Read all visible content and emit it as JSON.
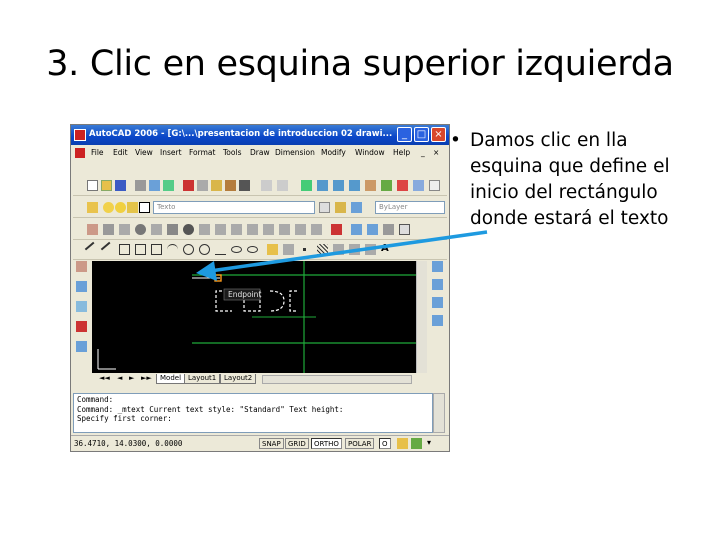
{
  "slide": {
    "title": "3. Clic en esquina superior izquierda",
    "bullet": "Damos clic en lla esquina que define el inicio del rectángulo donde estará el texto",
    "bullet_marker": "•"
  },
  "app": {
    "window_title": "AutoCAD 2006 - [G:\\...\\presentacion de introduccion 02 drawi...",
    "menu": [
      "File",
      "Edit",
      "View",
      "Insert",
      "Format",
      "Tools",
      "Draw",
      "Dimension",
      "Modify",
      "Window",
      "Help"
    ],
    "text_style_value": "Texto",
    "layer_value": "ByLayer",
    "snap_tooltip": "Endpoint",
    "tabs": [
      "Model",
      "Layout1",
      "Layout2"
    ],
    "command_lines": [
      "Command:",
      "Command: _mtext  Current text style:  \"Standard\"  Text height:",
      "Specify first corner:"
    ],
    "coords": "36.4710, 14.0300, 0.0000",
    "status_buttons": [
      "SNAP",
      "GRID",
      "ORTHO",
      "POLAR",
      "O"
    ],
    "active_status": "ORTHO",
    "colors": {
      "titlebar": "#0a46c8",
      "canvas": "#000000",
      "arrow": "#1e9ae0",
      "grid_lines": "#1faa3a"
    }
  }
}
